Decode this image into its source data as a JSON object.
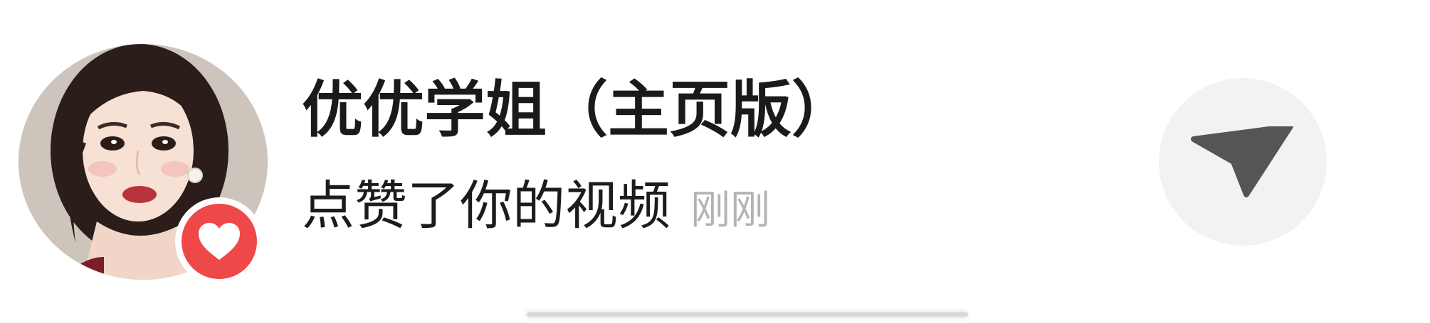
{
  "notification": {
    "user_name": "优优学姐（主页版）",
    "action_text": "点赞了你的视频",
    "time_text": "刚刚",
    "avatar_icon": "user-avatar",
    "badge_icon": "heart-icon",
    "share_icon": "send-icon"
  },
  "colors": {
    "badge": "#ee4848",
    "share_bg": "#f2f2f2",
    "share_icon": "#555558",
    "time_text": "#b3b3b3"
  }
}
